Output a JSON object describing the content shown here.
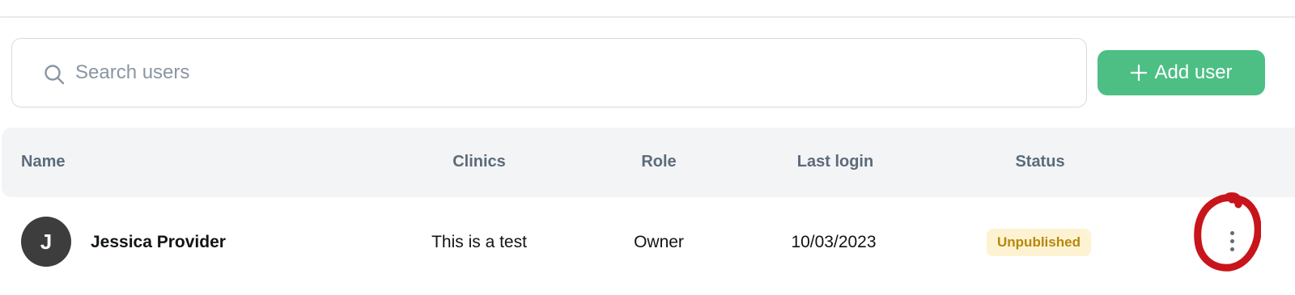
{
  "search": {
    "placeholder": "Search users",
    "icon": "search-icon"
  },
  "toolbar": {
    "add_button_label": "Add user",
    "add_button_icon": "plus-icon",
    "accent_color": "#4dbf85"
  },
  "table": {
    "columns": [
      "Name",
      "Clinics",
      "Role",
      "Last login",
      "Status"
    ],
    "rows": [
      {
        "avatar_initial": "J",
        "name": "Jessica Provider",
        "clinics": "This is a test",
        "role": "Owner",
        "last_login": "10/03/2023",
        "status": "Unpublished",
        "status_color": "#b8860b",
        "menu_icon": "kebab-menu-icon"
      }
    ]
  },
  "annotation": {
    "color": "#c8141b",
    "shape": "hand-drawn-circle"
  }
}
